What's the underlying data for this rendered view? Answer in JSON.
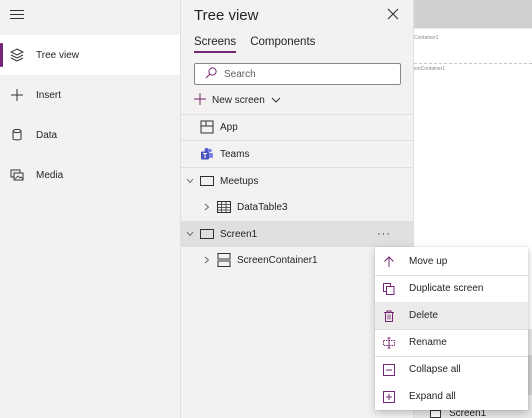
{
  "rail": {
    "items": [
      {
        "label": "Tree view",
        "icon": "layers-icon",
        "active": true
      },
      {
        "label": "Insert",
        "icon": "plus-icon"
      },
      {
        "label": "Data",
        "icon": "database-icon"
      },
      {
        "label": "Media",
        "icon": "media-icon"
      }
    ]
  },
  "panel": {
    "title": "Tree view",
    "tabs": [
      {
        "label": "Screens",
        "active": true
      },
      {
        "label": "Components"
      }
    ],
    "search": {
      "placeholder": "Search",
      "value": ""
    },
    "new_screen": "New screen",
    "nodes": [
      {
        "label": "App",
        "icon": "app-icon"
      },
      {
        "label": "Teams",
        "icon": "teams-icon"
      },
      {
        "label": "Meetups",
        "icon": "screen-icon",
        "expanded": true
      },
      {
        "label": "DataTable3",
        "icon": "table-icon",
        "collapsed": true
      },
      {
        "label": "Screen1",
        "icon": "screen-icon",
        "expanded": true,
        "selected": true
      },
      {
        "label": "ScreenContainer1",
        "icon": "container-icon",
        "collapsed": true
      }
    ],
    "more_label": "···"
  },
  "canvas": {
    "tag1": "Container1",
    "tag2": "ionContainer1",
    "screen_label": "Screen1"
  },
  "menu": {
    "items": [
      {
        "label": "Move up",
        "icon": "arrow-up-icon"
      },
      {
        "label": "Duplicate screen",
        "icon": "duplicate-icon"
      },
      {
        "label": "Delete",
        "icon": "trash-icon",
        "hover": true
      },
      {
        "label": "Rename",
        "icon": "rename-icon"
      },
      {
        "label": "Collapse all",
        "icon": "collapse-all-icon"
      },
      {
        "label": "Expand all",
        "icon": "expand-all-icon"
      }
    ]
  },
  "colors": {
    "accent": "#742774",
    "icon_accent": "#742774",
    "panel_bg": "#f3f2f1",
    "selected_bg": "#e1dfdd"
  }
}
